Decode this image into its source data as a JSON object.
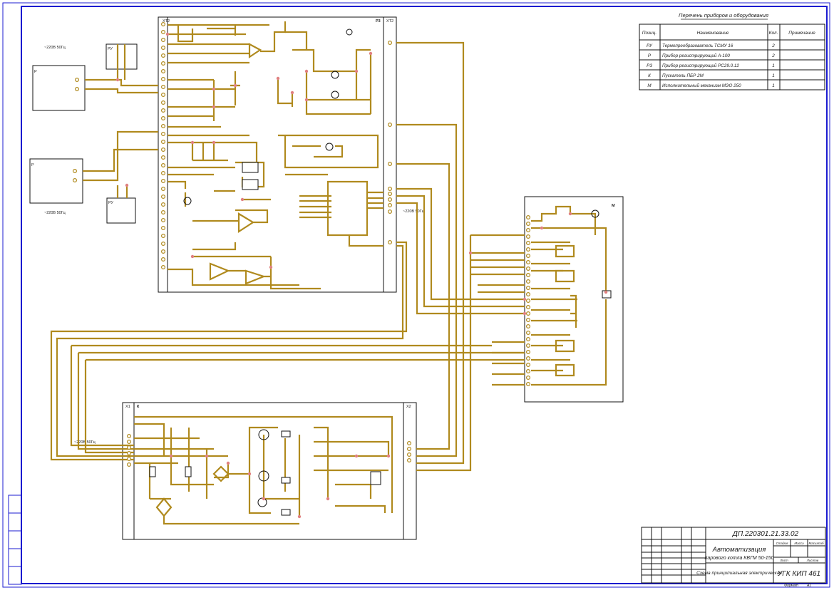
{
  "equipment_list": {
    "title": "Перечень приборов и оборудования",
    "headers": [
      "Позиц.",
      "Наименование",
      "Кол.",
      "Примечание"
    ],
    "rows": [
      [
        "РУ",
        "Термопреобразователь ТСМУ 16",
        "2",
        ""
      ],
      [
        "Р",
        "Прибор регистрирующий А-100",
        "2",
        ""
      ],
      [
        "Р3",
        "Прибор регистрирующий РС29.0.12",
        "1",
        ""
      ],
      [
        "К",
        "Пускатель ПБР 2М",
        "1",
        ""
      ],
      [
        "М",
        "Исполнительный механизм МЭО 250",
        "1",
        ""
      ]
    ]
  },
  "title_block": {
    "doc_code": "ДП.220301.21.33.02",
    "title_line1": "Автоматизация",
    "title_line2": "парового котла КВГМ 50-150",
    "subtitle": "Схема принципиальная электрическая",
    "org": "УГК КИП 461",
    "stage_label": "Стадия",
    "mass_label": "Масса",
    "scale_label": "Масштаб",
    "sheet_label": "Лист",
    "sheets_label": "Листов",
    "format_label": "Формат",
    "format_value": "А1"
  },
  "blocks": {
    "top_device": {
      "label": "Р3",
      "left_tag": "ХТ2",
      "right_tag": "ХТ2"
    },
    "motor": {
      "label": "М"
    },
    "starter": {
      "label": "К",
      "left_tag": "Х1",
      "right_tag": "Х2"
    },
    "rec1": {
      "label": "Р"
    },
    "rec2": {
      "label": "Р"
    },
    "pv1": {
      "label": "РУ"
    },
    "pv2": {
      "label": "РУ"
    }
  },
  "labels": {
    "supply_top": "~220В 50Гц",
    "supply_bottom": "~220В 50Гц",
    "supply_mid": "~220В 50Гц",
    "supply_starter": "~220В 50Гц"
  }
}
